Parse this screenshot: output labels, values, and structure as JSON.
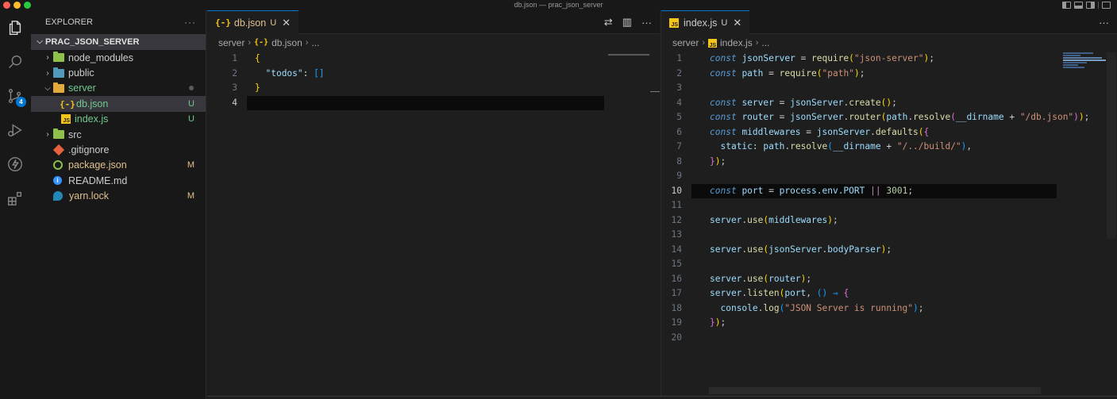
{
  "window": {
    "title": "db.json — prac_json_server"
  },
  "activity_bar": {
    "items": [
      {
        "icon": "files-icon"
      },
      {
        "icon": "search-icon"
      },
      {
        "icon": "source-control-icon",
        "badge": "4"
      },
      {
        "icon": "run-debug-icon"
      },
      {
        "icon": "lightning-icon"
      },
      {
        "icon": "extensions-icon"
      }
    ]
  },
  "explorer": {
    "header": "EXPLORER",
    "more": "···",
    "folder": "PRAC_JSON_SERVER",
    "items": [
      {
        "label": "node_modules",
        "status": ""
      },
      {
        "label": "public",
        "status": ""
      },
      {
        "label": "server",
        "status": "●"
      },
      {
        "label": "db.json",
        "status": "U"
      },
      {
        "label": "index.js",
        "status": "U"
      },
      {
        "label": "src",
        "status": ""
      },
      {
        "label": ".gitignore",
        "status": ""
      },
      {
        "label": "package.json",
        "status": "M"
      },
      {
        "label": "README.md",
        "status": ""
      },
      {
        "label": "yarn.lock",
        "status": "M"
      }
    ],
    "colors": {
      "untracked": "#73c991",
      "modified": "#e2c08d"
    }
  },
  "editor_left": {
    "tab": {
      "icon": "{-}",
      "label": "db.json",
      "status": "U",
      "close": "✕"
    },
    "actions": [
      "⇄",
      "▥",
      "···"
    ],
    "breadcrumb": [
      "server",
      "db.json",
      "..."
    ],
    "lines": [
      "1",
      "2",
      "3",
      "4"
    ],
    "code": {
      "l1": "{",
      "l2_key": "\"todos\"",
      "l2_colon": ": ",
      "l2_val": "[]",
      "l3": "}"
    }
  },
  "editor_right": {
    "tab": {
      "icon": "JS",
      "label": "index.js",
      "status": "U",
      "close": "✕"
    },
    "actions": [
      "···"
    ],
    "breadcrumb": [
      "server",
      "index.js",
      "..."
    ],
    "lines": [
      "1",
      "2",
      "3",
      "4",
      "5",
      "6",
      "7",
      "8",
      "9",
      "10",
      "11",
      "12",
      "13",
      "14",
      "15",
      "16",
      "17",
      "18",
      "19",
      "20"
    ],
    "code": {
      "kw": "const",
      "l1_var": "jsonServer",
      "l1_fn": "require",
      "l1_str": "\"json-server\"",
      "l2_var": "path",
      "l2_str": "\"path\"",
      "l4_var": "server",
      "l4_obj": "jsonServer",
      "l4_fn": "create",
      "l5_var": "router",
      "l5_fn": "router",
      "l5_fn2": "resolve",
      "l5_dir": "__dirname",
      "l5_str": "\"/db.json\"",
      "l6_var": "middlewares",
      "l6_fn": "defaults",
      "l7_key": "static",
      "l7_str": "\"/../build/\"",
      "l10_var": "port",
      "l10_env": "process.env.PORT",
      "l10_op": "||",
      "l10_num": "3001",
      "l12_fn": "use",
      "l12_arg": "middlewares",
      "l14_prop": "bodyParser",
      "l16_arg": "router",
      "l17_fn": "listen",
      "l17_arrow": "() ⇒",
      "l18_obj": "console",
      "l18_fn": "log",
      "l18_str": "\"JSON Server is running\""
    }
  },
  "colors": {
    "accent": "#0078d4",
    "badge": "#0078d4",
    "sidebar_bg": "#181818",
    "editor_bg": "#1e1e1e"
  }
}
